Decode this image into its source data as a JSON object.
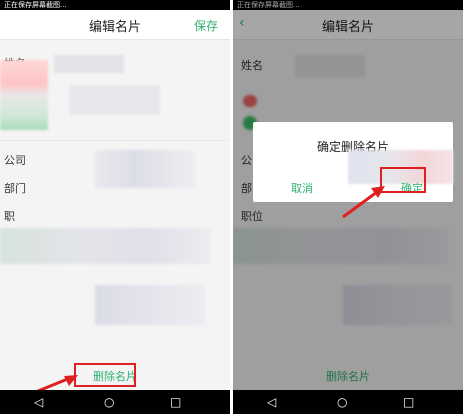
{
  "left": {
    "status_text": "正在保存屏幕截图...",
    "header": {
      "title": "编辑名片",
      "save_label": "保存"
    },
    "fields": {
      "name_label": "姓名",
      "company_label": "公司",
      "department_label": "部门",
      "position_label": "职"
    },
    "delete_label": "删除名片"
  },
  "right": {
    "status_text": "正在保存屏幕截图...",
    "header": {
      "title": "编辑名片",
      "back_icon": "‹"
    },
    "fields": {
      "name_label": "姓名",
      "company_label": "公",
      "department_label": "部",
      "position_label": "职位"
    },
    "dialog": {
      "title": "确定删除名片",
      "cancel_label": "取消",
      "confirm_label": "确定"
    },
    "delete_label": "删除名片"
  },
  "nav": {
    "back_icon": "◁",
    "home_icon": "○",
    "recent_icon": "□"
  },
  "colors": {
    "accent": "#2fb170",
    "highlight": "#e02020"
  }
}
